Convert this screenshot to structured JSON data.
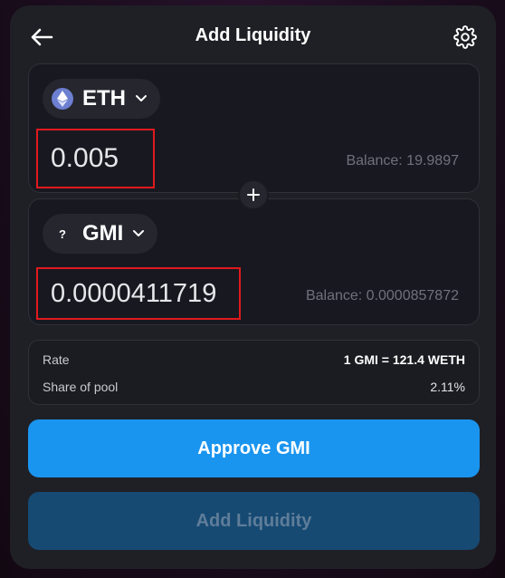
{
  "header": {
    "title": "Add Liquidity",
    "back_icon": "arrow-left-icon",
    "settings_icon": "gear-icon"
  },
  "input_a": {
    "token_symbol": "ETH",
    "token_icon": "ethereum-icon",
    "amount": "0.005",
    "balance": "Balance: 19.9897"
  },
  "plus_icon": "plus-icon",
  "input_b": {
    "token_symbol": "GMI",
    "token_icon": "question-mark-icon",
    "token_icon_glyph": "?",
    "amount": "0.0000411719",
    "balance": "Balance: 0.0000857872"
  },
  "info": {
    "rate_label": "Rate",
    "rate_value": "1 GMI = 121.4 WETH",
    "share_label": "Share of pool",
    "share_value": "2.11%"
  },
  "buttons": {
    "approve_label": "Approve GMI",
    "add_label": "Add Liquidity"
  },
  "colors": {
    "card_bg": "#1f2026",
    "accent": "#1a95ef",
    "disabled": "#164a73",
    "highlight_border": "#e0191e"
  }
}
